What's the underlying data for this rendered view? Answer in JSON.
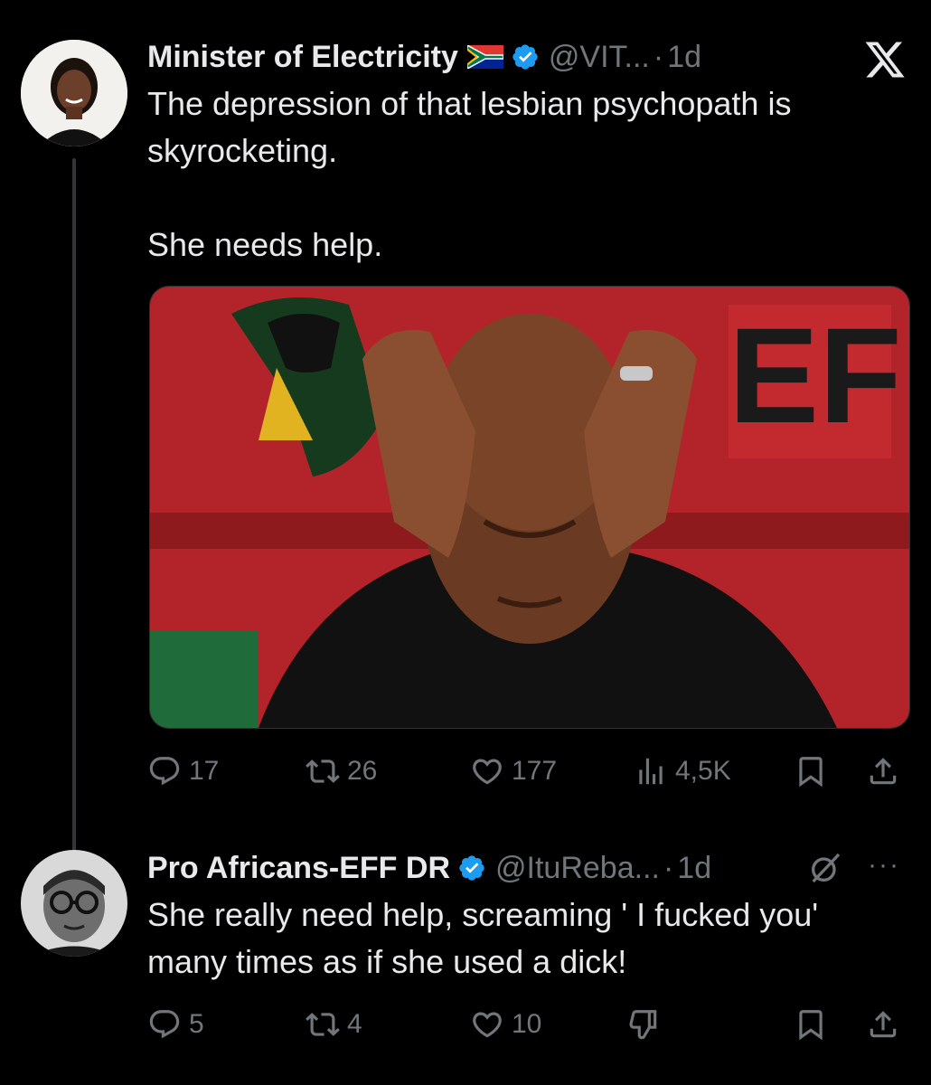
{
  "tweet1": {
    "name": "Minister of Electricity",
    "handle": "@VIT...",
    "dot": "·",
    "time": "1d",
    "text": "The depression of that lesbian psychopath is skyrocketing.\n\nShe needs help.",
    "image_text": "EFF",
    "stats": {
      "replies": "17",
      "retweets": "26",
      "likes": "177",
      "views": "4,5K"
    }
  },
  "tweet2": {
    "name": "Pro Africans-EFF DR",
    "handle": "@ItuReba...",
    "dot": "·",
    "time": "1d",
    "text": "She really need help, screaming ' I fucked you' many times as if she used a dick!",
    "more": "···",
    "stats": {
      "replies": "5",
      "retweets": "4",
      "likes": "10"
    }
  },
  "colors": {
    "background": "#000000",
    "text": "#e7e9ea",
    "muted": "#71767b",
    "verified": "#1d9bf0"
  },
  "icons": [
    "x-logo",
    "verified-icon",
    "sa-flag-icon",
    "reply-icon",
    "retweet-icon",
    "like-icon",
    "views-icon",
    "bookmark-icon",
    "share-icon",
    "grok-icon",
    "more-icon",
    "downvote-icon"
  ]
}
